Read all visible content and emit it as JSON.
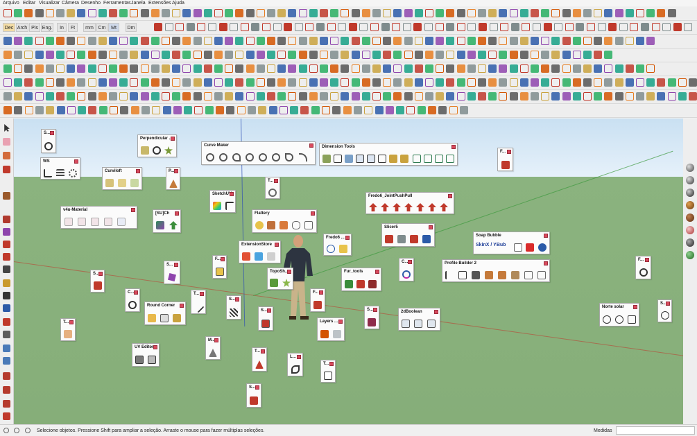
{
  "menu": [
    "Arquivo",
    "Editar",
    "Visualizar",
    "Câmera",
    "Desenho",
    "Ferramentas",
    "Janela",
    "Extensões",
    "Ajuda"
  ],
  "units": [
    "Dec",
    "Arch",
    "Pis",
    "Eng.",
    "In",
    "Ft",
    "mm",
    "Cm",
    "Mt",
    "Dm"
  ],
  "panels": {
    "s1": "S...",
    "perp": "Perpendicular ...",
    "curve": "Curve Maker",
    "dim": "Dimension Tools",
    "f1": "F...",
    "ws": "WS",
    "curviloft": "Curviloft",
    "p1": "P...",
    "t1": "T...",
    "sketchuv": "SketchUV",
    "v4u": "v4u-Material",
    "sujch": "[SU]Ch",
    "flattery": "Flattery",
    "fredo6jpp": "Fredo6_JointPushPull",
    "extstore": "ExtensionStore",
    "fredo6": "Fredo6 ...",
    "slicer": "Slicer5",
    "soap": "Soap Bubble",
    "f2": "F...",
    "c1": "C...",
    "pb2": "Profile Builder 2",
    "topo": "TopoSh...",
    "fur": "Fur_tools",
    "s2": "S...",
    "s3": "S...",
    "c2": "C...",
    "round": "Round Corner",
    "t2": "T...",
    "f3": "F...",
    "s4": "S...",
    "s5": "S...",
    "s6": "S...",
    "layers": "Layers ...",
    "booleans": "2dBoolean",
    "norte": "Norte solar",
    "s7": "S...",
    "t3": "T...",
    "uv": "UV Editor",
    "m1": "M...",
    "f4": "F...",
    "l1": "L...",
    "t4": "T...",
    "s8": "S..."
  },
  "soap_label": "SkinX / YBub",
  "status": {
    "message": "Selecione objetos. Pressione Shift para ampliar a seleção. Arraste o mouse para fazer múltiplas seleções.",
    "measure_label": "Medidas",
    "measure_value": ""
  },
  "colors": {
    "sky": "#d8e9f7",
    "ground": "#8ab17d",
    "axis_red": "#c0392b",
    "axis_green": "#3f9a3f",
    "axis_blue": "#2d4fb3",
    "close_button": "#d84a5d"
  },
  "icons": [
    "select-icon",
    "eraser-icon",
    "pencil-icon",
    "paint-bucket-icon",
    "move-icon",
    "rotate-icon",
    "scale-icon",
    "tape-icon",
    "orbit-icon",
    "pan-icon",
    "zoom-icon",
    "sphere-material-icon"
  ]
}
